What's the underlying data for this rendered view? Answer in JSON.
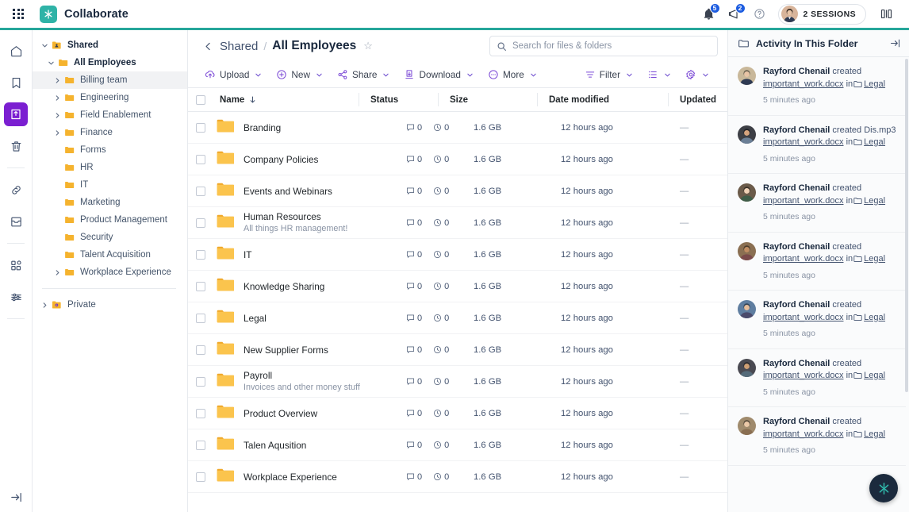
{
  "topbar": {
    "grid_icon": "app-switcher-icon",
    "brand": "Collaborate",
    "notifications_badge": "5",
    "alerts_badge": "2",
    "help_icon": "help-icon",
    "sessions_label": "2 SESSIONS",
    "split_icon": "split-view-icon"
  },
  "rail": {
    "items": [
      {
        "name": "home-icon",
        "active": false
      },
      {
        "name": "bookmark-icon",
        "active": false
      },
      {
        "name": "library-icon",
        "active": true
      },
      {
        "name": "trash-icon",
        "active": false
      },
      {
        "name": "link-icon",
        "active": false
      },
      {
        "name": "archive-icon",
        "active": false
      },
      {
        "name": "apps-icon",
        "active": false
      },
      {
        "name": "sliders-icon",
        "active": false
      }
    ],
    "collapse_icon": "collapse-sidebar-icon"
  },
  "tree": {
    "root": {
      "label": "Shared",
      "icon": "shared-folder-icon",
      "expanded": true
    },
    "items": [
      {
        "label": "All Employees",
        "expanded": true,
        "bold": true,
        "has_chevron": true,
        "highlight": false,
        "depth": 2
      },
      {
        "label": "Billing team",
        "expanded": false,
        "bold": false,
        "has_chevron": true,
        "highlight": true,
        "depth": 3
      },
      {
        "label": "Engineering",
        "expanded": false,
        "bold": false,
        "has_chevron": true,
        "highlight": false,
        "depth": 3
      },
      {
        "label": "Field Enablement",
        "expanded": false,
        "bold": false,
        "has_chevron": true,
        "highlight": false,
        "depth": 3
      },
      {
        "label": "Finance",
        "expanded": false,
        "bold": false,
        "has_chevron": true,
        "highlight": false,
        "depth": 3
      },
      {
        "label": "Forms",
        "expanded": false,
        "bold": false,
        "has_chevron": false,
        "highlight": false,
        "depth": 3
      },
      {
        "label": "HR",
        "expanded": false,
        "bold": false,
        "has_chevron": false,
        "highlight": false,
        "depth": 3
      },
      {
        "label": "IT",
        "expanded": false,
        "bold": false,
        "has_chevron": false,
        "highlight": false,
        "depth": 3
      },
      {
        "label": "Marketing",
        "expanded": false,
        "bold": false,
        "has_chevron": false,
        "highlight": false,
        "depth": 3
      },
      {
        "label": "Product Management",
        "expanded": false,
        "bold": false,
        "has_chevron": false,
        "highlight": false,
        "depth": 3
      },
      {
        "label": "Security",
        "expanded": false,
        "bold": false,
        "has_chevron": false,
        "highlight": false,
        "depth": 3
      },
      {
        "label": "Talent Acquisition",
        "expanded": false,
        "bold": false,
        "has_chevron": false,
        "highlight": false,
        "depth": 3
      },
      {
        "label": "Workplace Experience",
        "expanded": false,
        "bold": false,
        "has_chevron": true,
        "highlight": false,
        "depth": 3
      }
    ],
    "private": {
      "label": "Private",
      "icon": "private-folder-icon",
      "expanded": false
    }
  },
  "breadcrumb": {
    "back_icon": "chevron-left-icon",
    "parent": "Shared",
    "separator": "/",
    "current": "All Employees",
    "star_icon": "star-outline-icon"
  },
  "search": {
    "placeholder": "Search for files & folders",
    "value": "",
    "icon": "search-icon"
  },
  "toolbar": {
    "buttons": [
      {
        "label": "Upload",
        "icon": "upload-icon",
        "caret": true
      },
      {
        "label": "New",
        "icon": "plus-circle-icon",
        "caret": true
      },
      {
        "label": "Share",
        "icon": "share-icon",
        "caret": true
      },
      {
        "label": "Download",
        "icon": "download-icon",
        "caret": true
      },
      {
        "label": "More",
        "icon": "more-circle-icon",
        "caret": true
      }
    ],
    "right": [
      {
        "label": "Filter",
        "icon": "filter-icon",
        "caret": true
      },
      {
        "label": "",
        "icon": "list-view-icon",
        "caret": true
      },
      {
        "label": "",
        "icon": "gear-icon",
        "caret": true
      }
    ]
  },
  "table": {
    "columns": [
      "Name",
      "Status",
      "Size",
      "Date modified",
      "Updated"
    ],
    "sort_icon": "sort-descending-arrow",
    "rows": [
      {
        "name": "Branding",
        "desc": "",
        "comments": "0",
        "tasks": "0",
        "size": "1.6 GB",
        "modified": "12 hours ago",
        "updated": "—"
      },
      {
        "name": "Company Policies",
        "desc": "",
        "comments": "0",
        "tasks": "0",
        "size": "1.6 GB",
        "modified": "12 hours ago",
        "updated": "—"
      },
      {
        "name": "Events and Webinars",
        "desc": "",
        "comments": "0",
        "tasks": "0",
        "size": "1.6 GB",
        "modified": "12 hours ago",
        "updated": "—"
      },
      {
        "name": "Human Resources",
        "desc": "All things HR management!",
        "comments": "0",
        "tasks": "0",
        "size": "1.6 GB",
        "modified": "12 hours ago",
        "updated": "—"
      },
      {
        "name": "IT",
        "desc": "",
        "comments": "0",
        "tasks": "0",
        "size": "1.6 GB",
        "modified": "12 hours ago",
        "updated": "—"
      },
      {
        "name": "Knowledge Sharing",
        "desc": "",
        "comments": "0",
        "tasks": "0",
        "size": "1.6 GB",
        "modified": "12 hours ago",
        "updated": "—"
      },
      {
        "name": "Legal",
        "desc": "",
        "comments": "0",
        "tasks": "0",
        "size": "1.6 GB",
        "modified": "12 hours ago",
        "updated": "—"
      },
      {
        "name": "New Supplier Forms",
        "desc": "",
        "comments": "0",
        "tasks": "0",
        "size": "1.6 GB",
        "modified": "12 hours ago",
        "updated": "—"
      },
      {
        "name": "Payroll",
        "desc": "Invoices and other money stuff",
        "comments": "0",
        "tasks": "0",
        "size": "1.6 GB",
        "modified": "12 hours ago",
        "updated": "—"
      },
      {
        "name": "Product Overview",
        "desc": "",
        "comments": "0",
        "tasks": "0",
        "size": "1.6 GB",
        "modified": "12 hours ago",
        "updated": "—"
      },
      {
        "name": "Talen Aqusition",
        "desc": "",
        "comments": "0",
        "tasks": "0",
        "size": "1.6 GB",
        "modified": "12 hours ago",
        "updated": "—"
      },
      {
        "name": "Workplace Experience",
        "desc": "",
        "comments": "0",
        "tasks": "0",
        "size": "1.6 GB",
        "modified": "12 hours ago",
        "updated": "—"
      }
    ]
  },
  "activity": {
    "icon": "folder-activity-icon",
    "title": "Activity In This Folder",
    "close_icon": "collapse-panel-icon",
    "entries": [
      {
        "user": "Rayford Chenail",
        "action": "created",
        "extra": "",
        "file": "important_work.docx",
        "in": "in",
        "folder": "Legal",
        "time": "5 minutes ago",
        "avatar": "#c9b89a"
      },
      {
        "user": "Rayford Chenail",
        "action": "created",
        "extra": "Dis.mp3",
        "file": "important_work.docx",
        "in": "in",
        "folder": "Legal",
        "time": "5 minutes ago",
        "avatar": "#3d3f45"
      },
      {
        "user": "Rayford Chenail",
        "action": "created",
        "extra": "",
        "file": "important_work.docx",
        "in": "in",
        "folder": "Legal",
        "time": "5 minutes ago",
        "avatar": "#6b5b4a"
      },
      {
        "user": "Rayford Chenail",
        "action": "created",
        "extra": "",
        "file": "important_work.docx",
        "in": "in",
        "folder": "Legal",
        "time": "5 minutes ago",
        "avatar": "#8a6f52"
      },
      {
        "user": "Rayford Chenail",
        "action": "created",
        "extra": "",
        "file": "important_work.docx",
        "in": "in",
        "folder": "Legal",
        "time": "5 minutes ago",
        "avatar": "#5f7ea0"
      },
      {
        "user": "Rayford Chenail",
        "action": "created",
        "extra": "",
        "file": "important_work.docx",
        "in": "in",
        "folder": "Legal",
        "time": "5 minutes ago",
        "avatar": "#4a4a52"
      },
      {
        "user": "Rayford Chenail",
        "action": "created",
        "extra": "",
        "file": "important_work.docx",
        "in": "in",
        "folder": "Legal",
        "time": "5 minutes ago",
        "avatar": "#a08b6d"
      }
    ]
  },
  "fab": {
    "icon": "assistant-icon"
  },
  "colors": {
    "brand_teal": "#2fb3a7",
    "accent_purple": "#7b49d6",
    "folder_yellow": "#f5b32e",
    "badge_blue": "#1c5ce0",
    "rail_active": "#7b1fd1",
    "text_dark": "#19283d"
  }
}
